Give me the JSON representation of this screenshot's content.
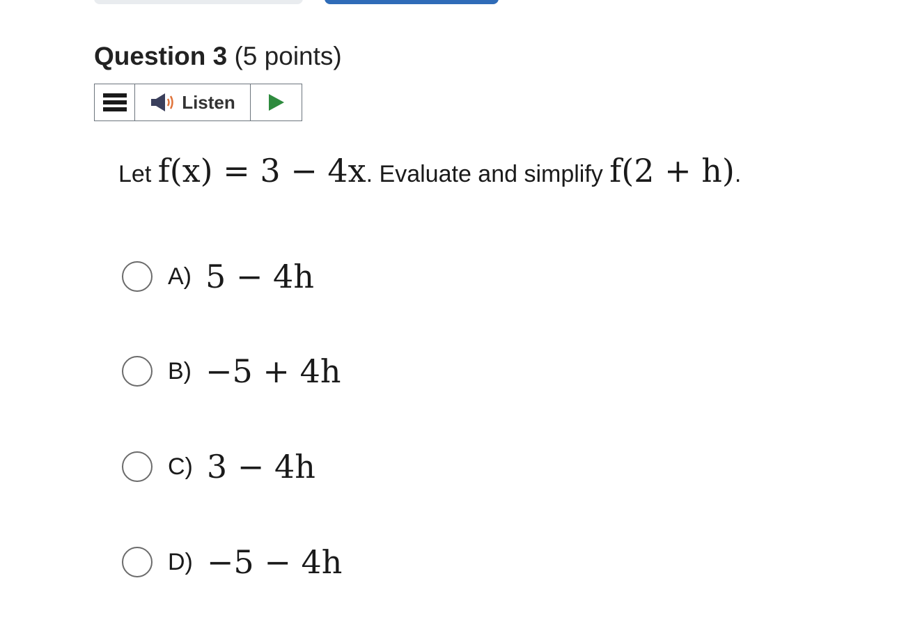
{
  "question": {
    "title": "Question 3",
    "points": "(5 points)"
  },
  "toolbar": {
    "listen_label": "Listen",
    "menu_icon": "menu-icon",
    "speaker_icon": "speaker-icon",
    "play_icon": "play-icon",
    "play_color": "#2e8b3e",
    "speaker_wave_color": "#e0733a"
  },
  "prompt": {
    "text_let": "Let",
    "func_def": "f(x) = 3 − 4x",
    "text_mid": ". Evaluate and simplify",
    "func_eval": "f(2 + h)",
    "text_end": "."
  },
  "options": [
    {
      "letter": "A)",
      "answer": "5 − 4h"
    },
    {
      "letter": "B)",
      "answer": "−5 + 4h"
    },
    {
      "letter": "C)",
      "answer": "3 − 4h"
    },
    {
      "letter": "D)",
      "answer": "−5 − 4h"
    }
  ],
  "colors": {
    "top_button_primary": "#2f6cb8",
    "top_button_secondary": "#e9ecef"
  }
}
